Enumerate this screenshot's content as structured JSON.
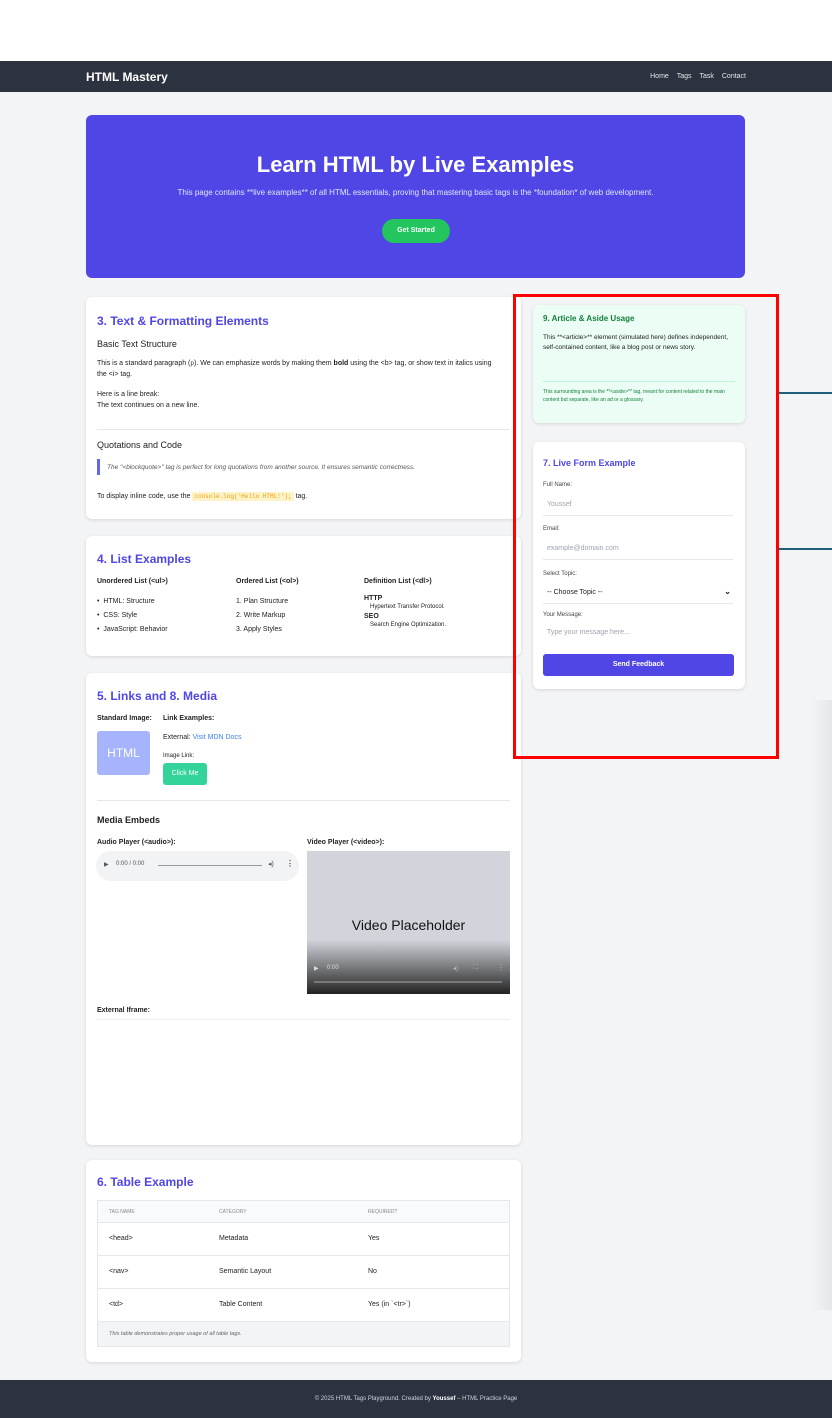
{
  "nav": {
    "brand": "HTML Mastery",
    "links": [
      "Home",
      "Tags",
      "Task",
      "Contact"
    ]
  },
  "hero": {
    "title": "Learn HTML by Live Examples",
    "subtitle": "This page contains **live examples** of all HTML essentials, proving that mastering basic tags is the *foundation* of web development.",
    "button": "Get Started"
  },
  "text_section": {
    "title": "3. Text & Formatting Elements",
    "basic_heading": "Basic Text Structure",
    "para_a": "This is a standard paragraph (",
    "para_p": "p",
    "para_b": "). We can emphasize words by making them ",
    "para_bold": "bold",
    "para_c": " using the <b> tag, or show text in italics using",
    "para_line2": "the <i> tag.",
    "break_line1": "Here is a line break:",
    "break_line2": "The text continues on a new line.",
    "quote_heading": "Quotations and Code",
    "quote": "The \"<blockquote>\" tag is perfect for long quotations from another source. It ensures semantic correctness.",
    "code_pre": "To display inline code, use the",
    "code": "console.log('Hello HTML!');",
    "code_post": "tag."
  },
  "lists": {
    "title": "4. List Examples",
    "ul_heading": "Unordered List (<ul>)",
    "ul_items": [
      "HTML: Structure",
      "CSS: Style",
      "JavaScript: Behavior"
    ],
    "ol_heading": "Ordered List (<ol>)",
    "ol_items": [
      "1. Plan Structure",
      "2. Write Markup",
      "3. Apply Styles"
    ],
    "dl_heading": "Definition List (<dl>)",
    "dl": [
      {
        "term": "HTTP",
        "def": "Hypertext Transfer Protocol."
      },
      {
        "term": "SEO",
        "def": "Search Engine Optimization."
      }
    ]
  },
  "media": {
    "title": "5. Links and 8. Media",
    "standard_image": "Standard Image:",
    "image_text": "HTML",
    "link_examples": "Link Examples:",
    "external_label": "External:",
    "external_link": "Visit MDN Docs",
    "image_link": "Image Link:",
    "click_me": "Click Me",
    "embeds_heading": "Media Embeds",
    "audio_label": "Audio Player (<audio>):",
    "audio_time": "0:00 / 0:00",
    "video_label": "Video Player (<video>):",
    "video_placeholder": "Video Placeholder",
    "video_time": "0:00",
    "iframe_label": "External Iframe:"
  },
  "table": {
    "title": "6. Table Example",
    "headers": [
      "TAG NAME",
      "CATEGORY",
      "REQUIRED?"
    ],
    "rows": [
      [
        "<head>",
        "Metadata",
        "Yes"
      ],
      [
        "<nav>",
        "Semantic Layout",
        "No"
      ],
      [
        "<td>",
        "Table Content",
        "Yes (in `<tr>`)"
      ]
    ],
    "caption": "This table demonstrates proper usage of all table tags."
  },
  "aside": {
    "title": "9. Article & Aside Usage",
    "body": "This **<article>** element (simulated here) defines independent, self-contained content, like a blog post or news story.",
    "note": "This surrounding area is the **<aside>** tag, meant for content related to the main content but separate, like an ad or a glossary."
  },
  "form": {
    "title": "7. Live Form Example",
    "name_label": "Full Name:",
    "name_placeholder": "Youssef",
    "email_label": "Email:",
    "email_placeholder": "example@domain.com",
    "topic_label": "Select Topic:",
    "topic_value": "-- Choose Topic --",
    "message_label": "Your Message:",
    "message_placeholder": "Type your message here...",
    "submit": "Send Feedback"
  },
  "footer": {
    "pre": "© 2025 HTML Tags Playground. Created by ",
    "author": "Youssef",
    "post": " – HTML Practice Page"
  },
  "colors": {
    "accent": "#4f46e5",
    "green": "#22c55e",
    "nav": "#2d3240",
    "highlight": "#ff0000"
  }
}
